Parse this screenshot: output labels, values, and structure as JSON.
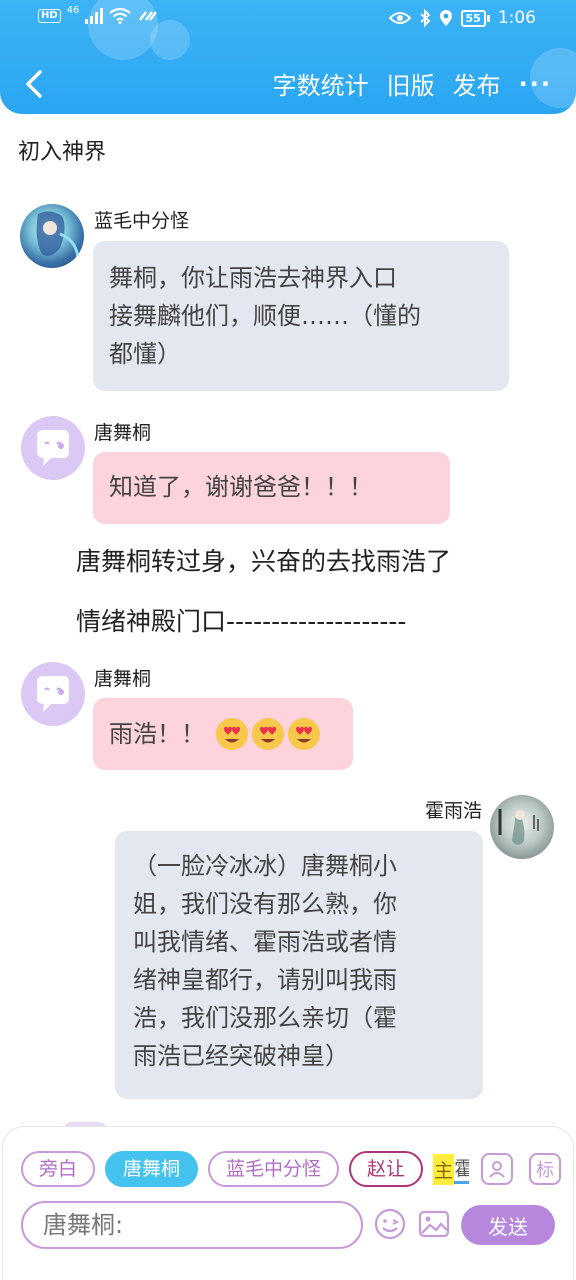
{
  "status_bar": {
    "network_label": "HD",
    "signal_label": "46",
    "battery": "55",
    "time": "1:06"
  },
  "header": {
    "actions": [
      "字数统计",
      "旧版",
      "发布"
    ],
    "more_label": "···"
  },
  "chapter_title": "初入神界",
  "messages": [
    {
      "name": "蓝毛中分怪",
      "lines": [
        "舞桐，你让雨浩去神界入口",
        "接舞麟他们，顺便……（懂的",
        "都懂）"
      ]
    },
    {
      "name": "唐舞桐",
      "text": "知道了，谢谢爸爸！！！"
    },
    {
      "name": "唐舞桐",
      "text": "雨浩！！",
      "emoji": "😍😍😍"
    },
    {
      "name": "霍雨浩",
      "lines": [
        "（一脸冷冰冰）唐舞桐小",
        "姐，我们没有那么熟，你",
        "叫我情绪、霍雨浩或者情",
        "绪神皇都行，请别叫我雨",
        "浩，我们没那么亲切（霍",
        "雨浩已经突破神皇）"
      ]
    }
  ],
  "narration": [
    "唐舞桐转过身，兴奋的去找雨浩了",
    "情绪神殿门口--------------------"
  ],
  "bottom": {
    "chips": [
      "旁白",
      "唐舞桐",
      "蓝毛中分怪",
      "赵让"
    ],
    "chip_clip": {
      "highlight": "主",
      "cut": "霍"
    },
    "tool_person": "person-icon",
    "tool_mark_label": "标",
    "input_placeholder": "唐舞桐:",
    "send_label": "发送"
  },
  "colors": {
    "header": "#2aa6f2",
    "gray_bubble": "#e3e7ef",
    "pink_bubble": "#fdd3dc",
    "accent_purple": "#b787de",
    "active_chip": "#44c3ef"
  }
}
